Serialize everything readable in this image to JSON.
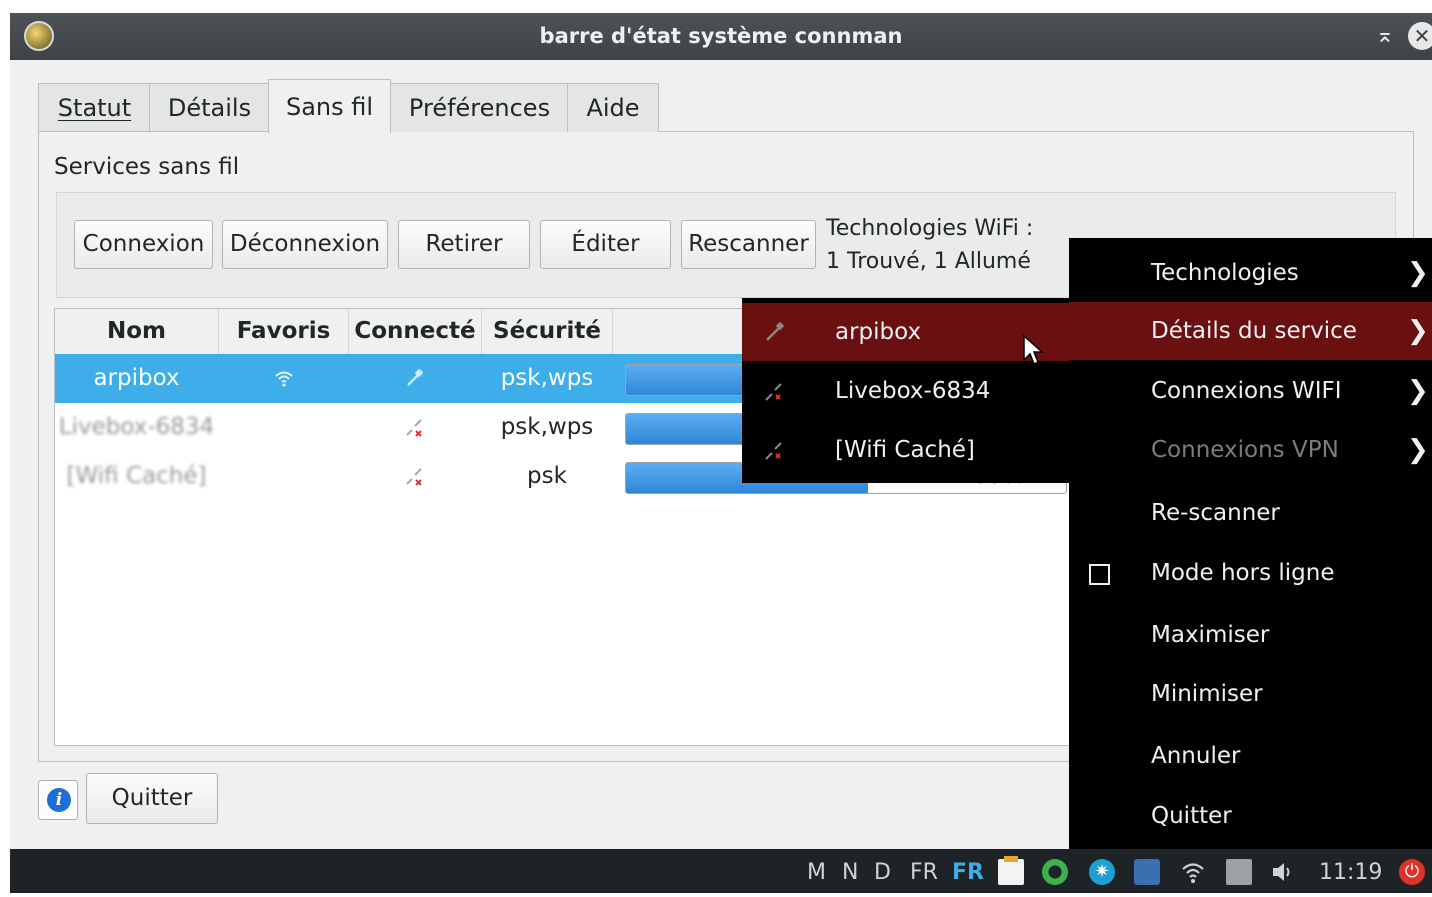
{
  "window": {
    "title": "barre d'état système connman",
    "keep_above_glyph": "⌅",
    "close_glyph": "✕"
  },
  "tabs": [
    {
      "label": "Statut",
      "u": 0
    },
    {
      "label": "Détails",
      "u": 0
    },
    {
      "label": "Sans fil",
      "u": 0,
      "active": true
    },
    {
      "label": "Préférences",
      "u": 0
    },
    {
      "label": "Aide",
      "u": 0
    }
  ],
  "wireless": {
    "group_title": "Services sans fil",
    "buttons": {
      "connect": "Connexion",
      "disconnect": "Déconnexion",
      "remove": "Retirer",
      "edit": "Éditer",
      "rescan": "Rescanner"
    },
    "tech_line1": "Technologies WiFi :",
    "tech_line2": "1 Trouvé, 1 Allumé",
    "table": {
      "headers": [
        "Nom",
        "Favoris",
        "Connecté",
        "Sécurité",
        ""
      ],
      "rows": [
        {
          "name": "arpibox",
          "favorite": true,
          "connected": "connected-icon",
          "security": "psk,wps",
          "signal": 0.62,
          "selected": true
        },
        {
          "name": "Livebox-6834",
          "favorite": false,
          "connected": "disconnected-icon",
          "security": "psk,wps",
          "signal": 0.55
        },
        {
          "name": "[Wifi Caché]",
          "favorite": false,
          "connected": "disconnected-icon",
          "security": "psk",
          "signal": 0.55
        }
      ],
      "partial_value": "55%"
    }
  },
  "footer": {
    "quit": "Quitter"
  },
  "tray_menu": {
    "items": [
      {
        "label": "Technologies",
        "submenu": true
      },
      {
        "label": "Détails du service",
        "submenu": true,
        "highlighted": true
      },
      {
        "label": "Connexions WIFI",
        "submenu": true
      },
      {
        "label": "Connexions VPN",
        "submenu": true,
        "disabled": true
      },
      {
        "label": "Re-scanner"
      },
      {
        "label": "Mode hors ligne",
        "checkbox": true,
        "checked": false
      },
      {
        "label": "Maximiser"
      },
      {
        "label": "Minimiser"
      },
      {
        "label": "Annuler"
      },
      {
        "label": "Quitter"
      }
    ],
    "arrow": "❯"
  },
  "service_submenu": {
    "items": [
      {
        "label": "arpibox",
        "highlighted": true
      },
      {
        "label": "Livebox-6834"
      },
      {
        "label": "[Wifi Caché]"
      }
    ]
  },
  "taskbar": {
    "desktops": [
      "M",
      "N",
      "D"
    ],
    "layout1": "FR",
    "layout2": "FR",
    "clock": "11:19"
  },
  "colors": {
    "selection": "#3daee9",
    "menu_highlight": "#6b1010",
    "progress": "#2f87d8",
    "power": "#e0322c"
  }
}
